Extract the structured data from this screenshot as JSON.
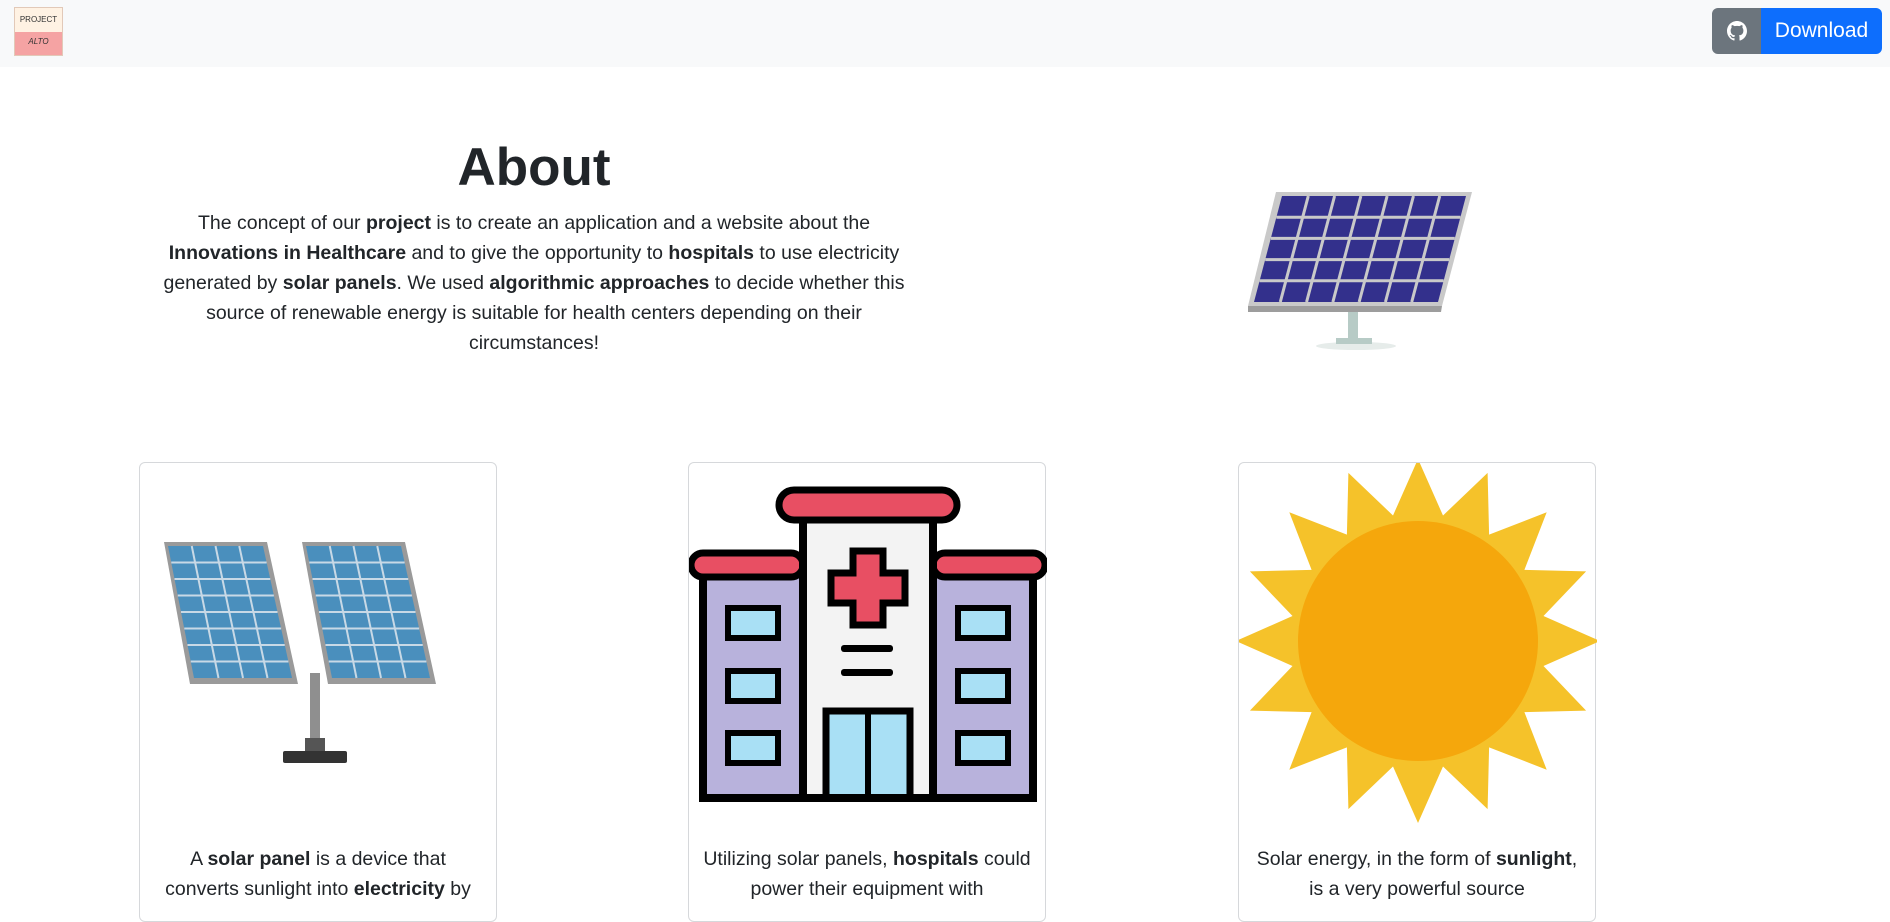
{
  "navbar": {
    "logo_line1": "PROJECT",
    "logo_line2": "ALTO",
    "github_icon": "github-icon",
    "download_label": "Download"
  },
  "about": {
    "title": "About",
    "segments": [
      {
        "text": "The concept of our ",
        "bold": false
      },
      {
        "text": "project",
        "bold": true
      },
      {
        "text": " is to create an application and a website about the ",
        "bold": false
      },
      {
        "text": "Innovations in Healthcare",
        "bold": true
      },
      {
        "text": " and to give the opportunity to ",
        "bold": false
      },
      {
        "text": "hospitals",
        "bold": true
      },
      {
        "text": " to use electricity generated by ",
        "bold": false
      },
      {
        "text": "solar panels",
        "bold": true
      },
      {
        "text": ". We used ",
        "bold": false
      },
      {
        "text": "algorithmic approaches",
        "bold": true
      },
      {
        "text": " to decide whether this source of renewable energy is suitable for health centers depending on their circumstances!",
        "bold": false
      }
    ]
  },
  "cards": [
    {
      "icon": "solar-panels-icon",
      "segments": [
        {
          "text": "A ",
          "bold": false
        },
        {
          "text": "solar panel",
          "bold": true
        },
        {
          "text": " is a device that converts sunlight into ",
          "bold": false
        },
        {
          "text": "electricity",
          "bold": true
        },
        {
          "text": " by",
          "bold": false
        }
      ]
    },
    {
      "icon": "hospital-icon",
      "segments": [
        {
          "text": "Utilizing solar panels, ",
          "bold": false
        },
        {
          "text": "hospitals",
          "bold": true
        },
        {
          "text": " could power their equipment with",
          "bold": false
        }
      ]
    },
    {
      "icon": "sun-icon",
      "segments": [
        {
          "text": "Solar energy, in the form of ",
          "bold": false
        },
        {
          "text": "sunlight",
          "bold": true
        },
        {
          "text": ", is a very powerful source",
          "bold": false
        }
      ]
    }
  ],
  "colors": {
    "primary": "#0d6efd",
    "secondary": "#6c757d",
    "navbar_bg": "#f8f9fa"
  }
}
